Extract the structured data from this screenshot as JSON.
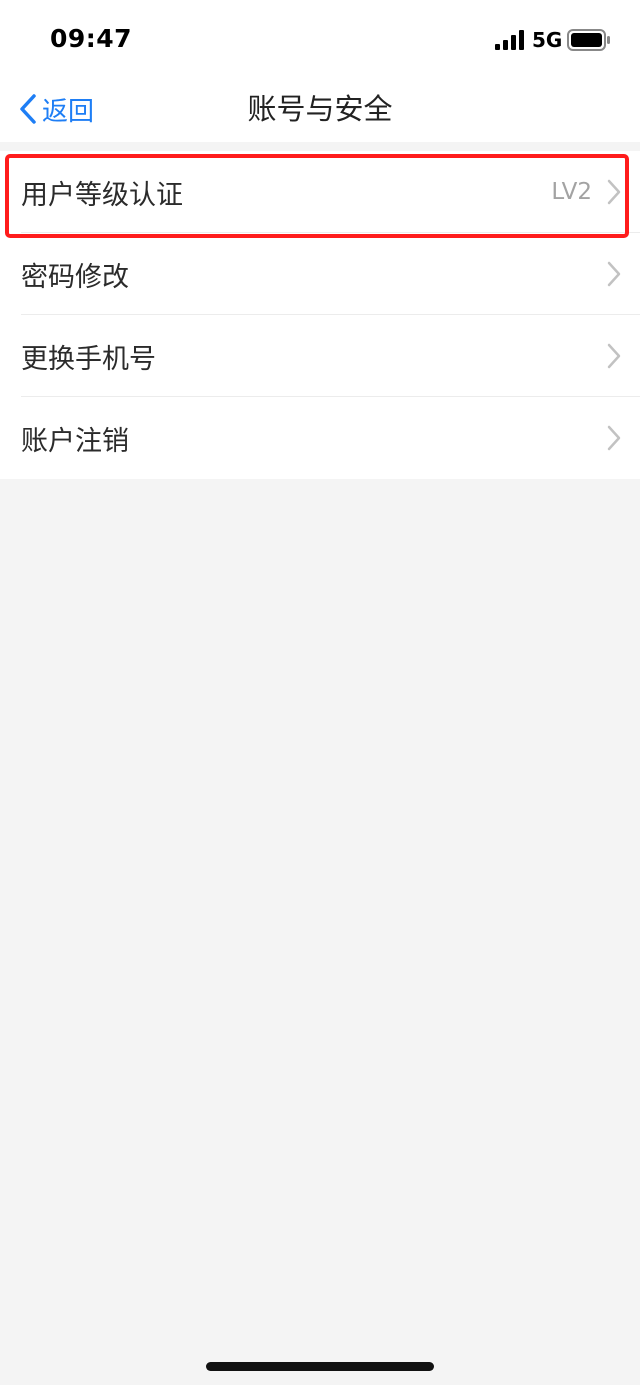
{
  "status_bar": {
    "time": "09:47",
    "network": "5G",
    "signal_icon": "signal-bars-icon",
    "battery_icon": "battery-icon"
  },
  "nav": {
    "back_label": "返回",
    "back_icon": "chevron-left-icon",
    "title": "账号与安全"
  },
  "settings": {
    "items": [
      {
        "label": "用户等级认证",
        "value": "LV2"
      },
      {
        "label": "密码修改",
        "value": ""
      },
      {
        "label": "更换手机号",
        "value": ""
      },
      {
        "label": "账户注销",
        "value": ""
      }
    ]
  },
  "colors": {
    "accent": "#1e7ef5",
    "highlight": "#ff1c1c",
    "background": "#f4f4f4",
    "value_text": "#a3a3a3"
  }
}
